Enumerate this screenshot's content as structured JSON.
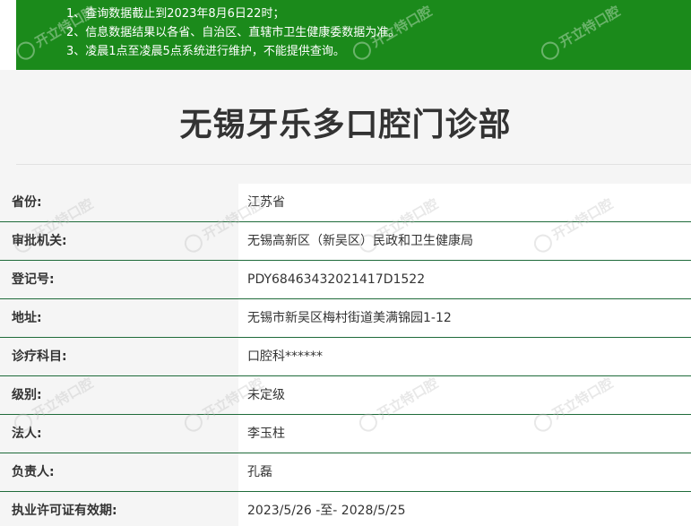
{
  "notice": {
    "lines": [
      "1、查询数据截止到2023年8月6日22时；",
      "2、信息数据结果以各省、自治区、直辖市卫生健康委数据为准。",
      "3、凌晨1点至凌晨5点系统进行维护，不能提供查询。"
    ]
  },
  "title": "无锡牙乐多口腔门诊部",
  "rows": [
    {
      "label": "省份:",
      "value": "江苏省"
    },
    {
      "label": "审批机关:",
      "value": "无锡高新区（新吴区）民政和卫生健康局"
    },
    {
      "label": "登记号:",
      "value": "PDY68463432021417D1522"
    },
    {
      "label": "地址:",
      "value": "无锡市新吴区梅村街道美满锦园1-12"
    },
    {
      "label": "诊疗科目:",
      "value": "口腔科******"
    },
    {
      "label": "级别:",
      "value": "未定级"
    },
    {
      "label": "法人:",
      "value": "李玉柱"
    },
    {
      "label": "负责人:",
      "value": "孔磊"
    },
    {
      "label": "执业许可证有效期:",
      "value": "2023/5/26 -至- 2028/5/25"
    }
  ],
  "watermark": {
    "text": "开立特口腔",
    "icon": "tooth-logo-icon"
  }
}
